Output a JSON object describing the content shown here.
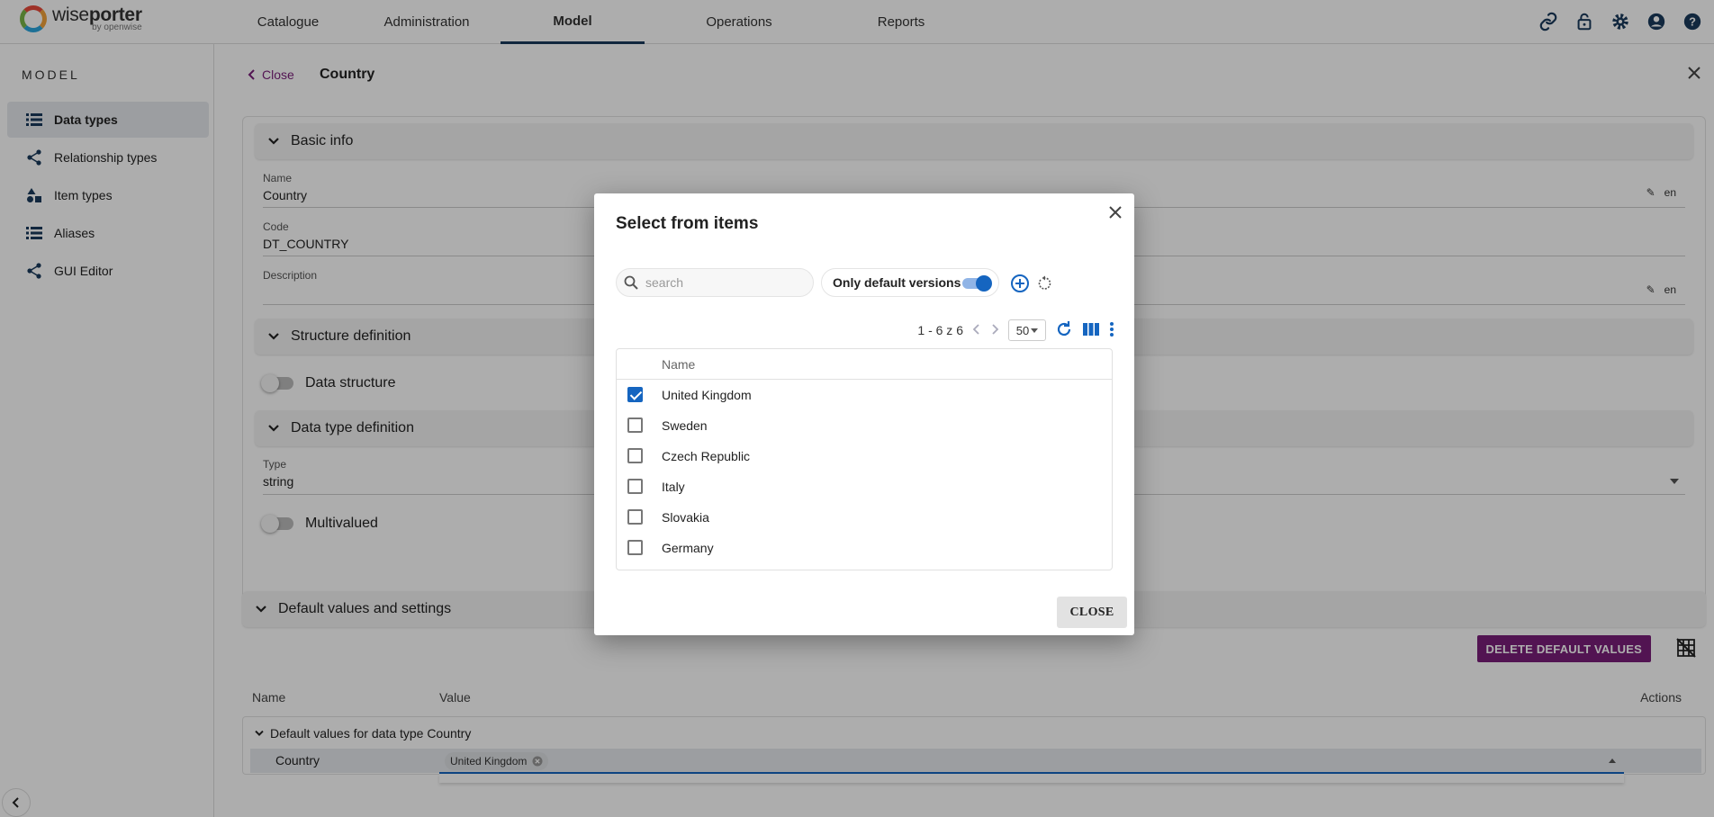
{
  "brand": {
    "name_light": "wise",
    "name_bold": "porter",
    "tagline": "by openwise"
  },
  "nav": {
    "items": [
      {
        "label": "Catalogue"
      },
      {
        "label": "Administration"
      },
      {
        "label": "Model",
        "active": true
      },
      {
        "label": "Operations"
      },
      {
        "label": "Reports"
      }
    ]
  },
  "top_icons": [
    "link-icon",
    "lock-icon",
    "gear-icon",
    "account-icon",
    "help-icon"
  ],
  "sidebar": {
    "title": "MODEL",
    "items": [
      {
        "label": "Data types",
        "icon": "list-icon",
        "active": true
      },
      {
        "label": "Relationship types",
        "icon": "share-icon"
      },
      {
        "label": "Item types",
        "icon": "shapes-icon"
      },
      {
        "label": "Aliases",
        "icon": "list-icon"
      },
      {
        "label": "GUI Editor",
        "icon": "share-icon"
      }
    ]
  },
  "detail": {
    "close_label": "Close",
    "title": "Country",
    "basic_info": "Basic info",
    "name_label": "Name",
    "name_value": "Country",
    "code_label": "Code",
    "code_value": "DT_COUNTRY",
    "description_label": "Description",
    "lang": "en",
    "structure_definition": "Structure definition",
    "data_structure": "Data structure",
    "data_type_definition": "Data type definition",
    "type_label": "Type",
    "type_value": "string",
    "multivalued": "Multivalued",
    "default_values_settings": "Default values and settings",
    "delete_default_values": "DELETE DEFAULT VALUES",
    "col_name": "Name",
    "col_value": "Value",
    "col_actions": "Actions",
    "group_label": "Default values for data type Country",
    "row_name": "Country",
    "row_chip": "United Kingdom"
  },
  "dialog": {
    "title": "Select from items",
    "search_placeholder": "search",
    "only_default_versions": "Only default versions",
    "pager_text": "1 - 6 z 6",
    "per_page": "50",
    "column_name": "Name",
    "rows": [
      {
        "label": "United Kingdom",
        "checked": true
      },
      {
        "label": "Sweden",
        "checked": false
      },
      {
        "label": "Czech Republic",
        "checked": false
      },
      {
        "label": "Italy",
        "checked": false
      },
      {
        "label": "Slovakia",
        "checked": false
      },
      {
        "label": "Germany",
        "checked": false
      }
    ],
    "close_button": "CLOSE"
  },
  "colors": {
    "accent": "#7a1e7a",
    "primary": "#1565c0",
    "nav_active": "#1a3a5c"
  }
}
